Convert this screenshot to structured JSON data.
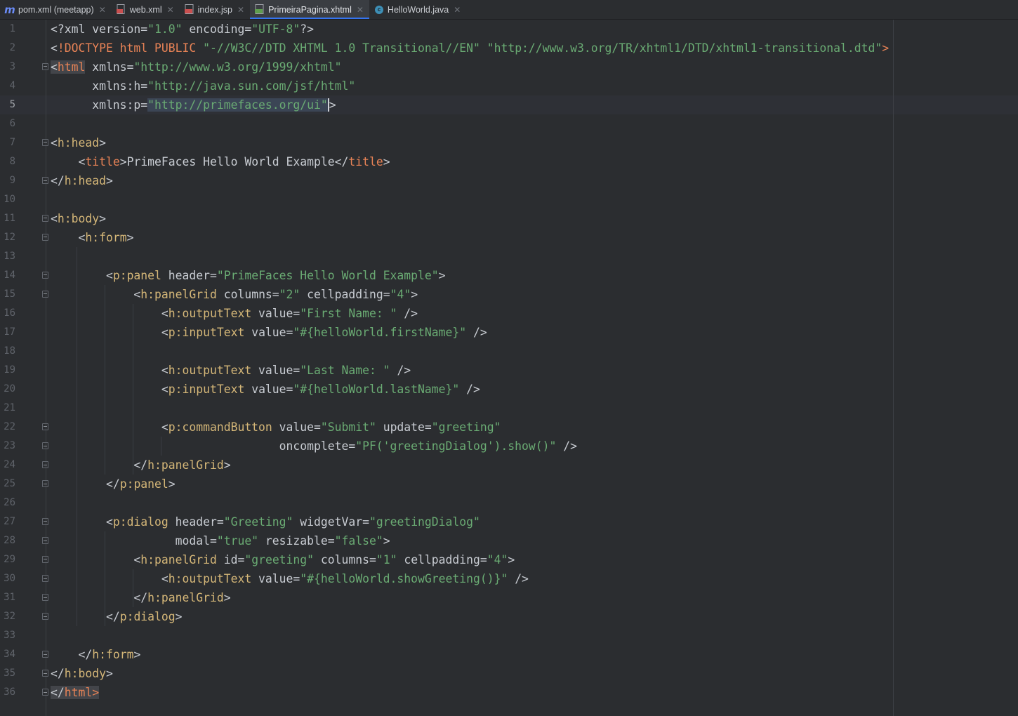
{
  "tabs": [
    {
      "label": "pom.xml (meetapp)",
      "icon": "maven-icon",
      "active": false
    },
    {
      "label": "web.xml",
      "icon": "xml-file-icon",
      "active": false
    },
    {
      "label": "index.jsp",
      "icon": "jsp-file-icon",
      "active": false
    },
    {
      "label": "PrimeiraPagina.xhtml",
      "icon": "jsf-file-icon",
      "active": true
    },
    {
      "label": "HelloWorld.java",
      "icon": "java-class-icon",
      "active": false
    }
  ],
  "editor": {
    "current_line": 5,
    "lines": [
      "<?xml version=\"1.0\" encoding=\"UTF-8\"?>",
      "<!DOCTYPE html PUBLIC \"-//W3C//DTD XHTML 1.0 Transitional//EN\" \"http://www.w3.org/TR/xhtml1/DTD/xhtml1-transitional.dtd\">",
      "<html xmlns=\"http://www.w3.org/1999/xhtml\"",
      "      xmlns:h=\"http://java.sun.com/jsf/html\"",
      "      xmlns:p=\"http://primefaces.org/ui\">",
      "",
      "<h:head>",
      "    <title>PrimeFaces Hello World Example</title>",
      "</h:head>",
      "",
      "<h:body>",
      "    <h:form>",
      "",
      "        <p:panel header=\"PrimeFaces Hello World Example\">",
      "            <h:panelGrid columns=\"2\" cellpadding=\"4\">",
      "                <h:outputText value=\"First Name: \" />",
      "                <p:inputText value=\"#{helloWorld.firstName}\" />",
      "",
      "                <h:outputText value=\"Last Name: \" />",
      "                <p:inputText value=\"#{helloWorld.lastName}\" />",
      "",
      "                <p:commandButton value=\"Submit\" update=\"greeting\"",
      "                                 oncomplete=\"PF('greetingDialog').show()\" />",
      "            </h:panelGrid>",
      "        </p:panel>",
      "",
      "        <p:dialog header=\"Greeting\" widgetVar=\"greetingDialog\"",
      "                  modal=\"true\" resizable=\"false\">",
      "            <h:panelGrid id=\"greeting\" columns=\"1\" cellpadding=\"4\">",
      "                <h:outputText value=\"#{helloWorld.showGreeting()}\" />",
      "            </h:panelGrid>",
      "        </p:dialog>",
      "",
      "    </h:form>",
      "</h:body>",
      "</html>"
    ]
  }
}
